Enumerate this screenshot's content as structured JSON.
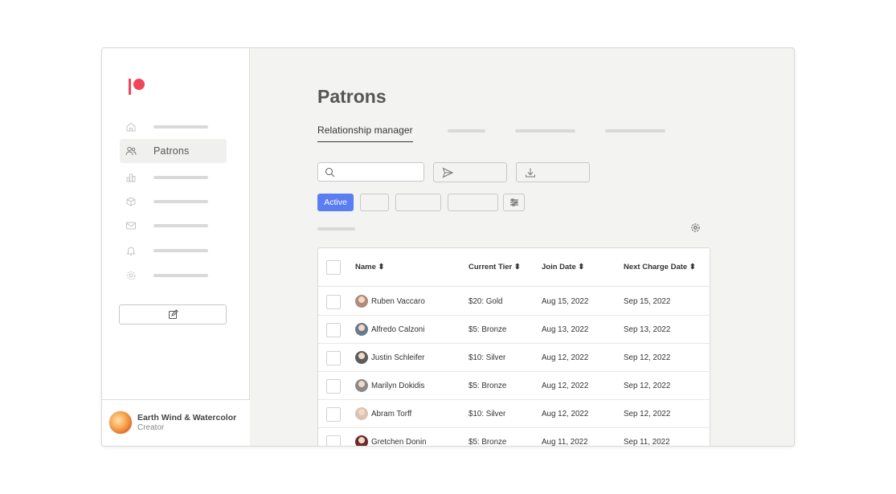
{
  "sidebar": {
    "nav": [
      {
        "icon": "home-icon",
        "label": ""
      },
      {
        "icon": "users-icon",
        "label": "Patrons"
      },
      {
        "icon": "chart-icon",
        "label": ""
      },
      {
        "icon": "box-icon",
        "label": ""
      },
      {
        "icon": "mail-icon",
        "label": ""
      },
      {
        "icon": "bell-icon",
        "label": ""
      },
      {
        "icon": "gear-icon",
        "label": ""
      }
    ],
    "profile": {
      "name": "Earth Wind & Watercolor",
      "role": "Creator"
    }
  },
  "main": {
    "title": "Patrons",
    "active_tab": "Relationship manager",
    "filters": {
      "active_label": "Active"
    },
    "table": {
      "headers": [
        "Name ⬍",
        "Current Tier ⬍",
        "Join Date ⬍",
        "Next Charge Date ⬍"
      ],
      "rows": [
        {
          "name": "Ruben Vaccaro",
          "tier": "$20: Gold",
          "join": "Aug 15, 2022",
          "next": "Sep 15, 2022",
          "avatar_color": "#b08a7a"
        },
        {
          "name": "Alfredo Calzoni",
          "tier": "$5: Bronze",
          "join": "Aug 13, 2022",
          "next": "Sep 13, 2022",
          "avatar_color": "#6a7a8c"
        },
        {
          "name": "Justin Schleifer",
          "tier": "$10: Silver",
          "join": "Aug 12, 2022",
          "next": "Sep 12, 2022",
          "avatar_color": "#5d5d5d"
        },
        {
          "name": "Marilyn Dokidis",
          "tier": "$5: Bronze",
          "join": "Aug 12, 2022",
          "next": "Sep 12, 2022",
          "avatar_color": "#8a8a8a"
        },
        {
          "name": "Abram Torff",
          "tier": "$10: Silver",
          "join": "Aug 12, 2022",
          "next": "Sep 12, 2022",
          "avatar_color": "#d9c4b4"
        },
        {
          "name": "Gretchen Donin",
          "tier": "$5: Bronze",
          "join": "Aug 11, 2022",
          "next": "Sep 11, 2022",
          "avatar_color": "#6b2a2a"
        }
      ]
    }
  },
  "colors": {
    "brand": "#f1465a",
    "accent": "#5a7ef2"
  }
}
